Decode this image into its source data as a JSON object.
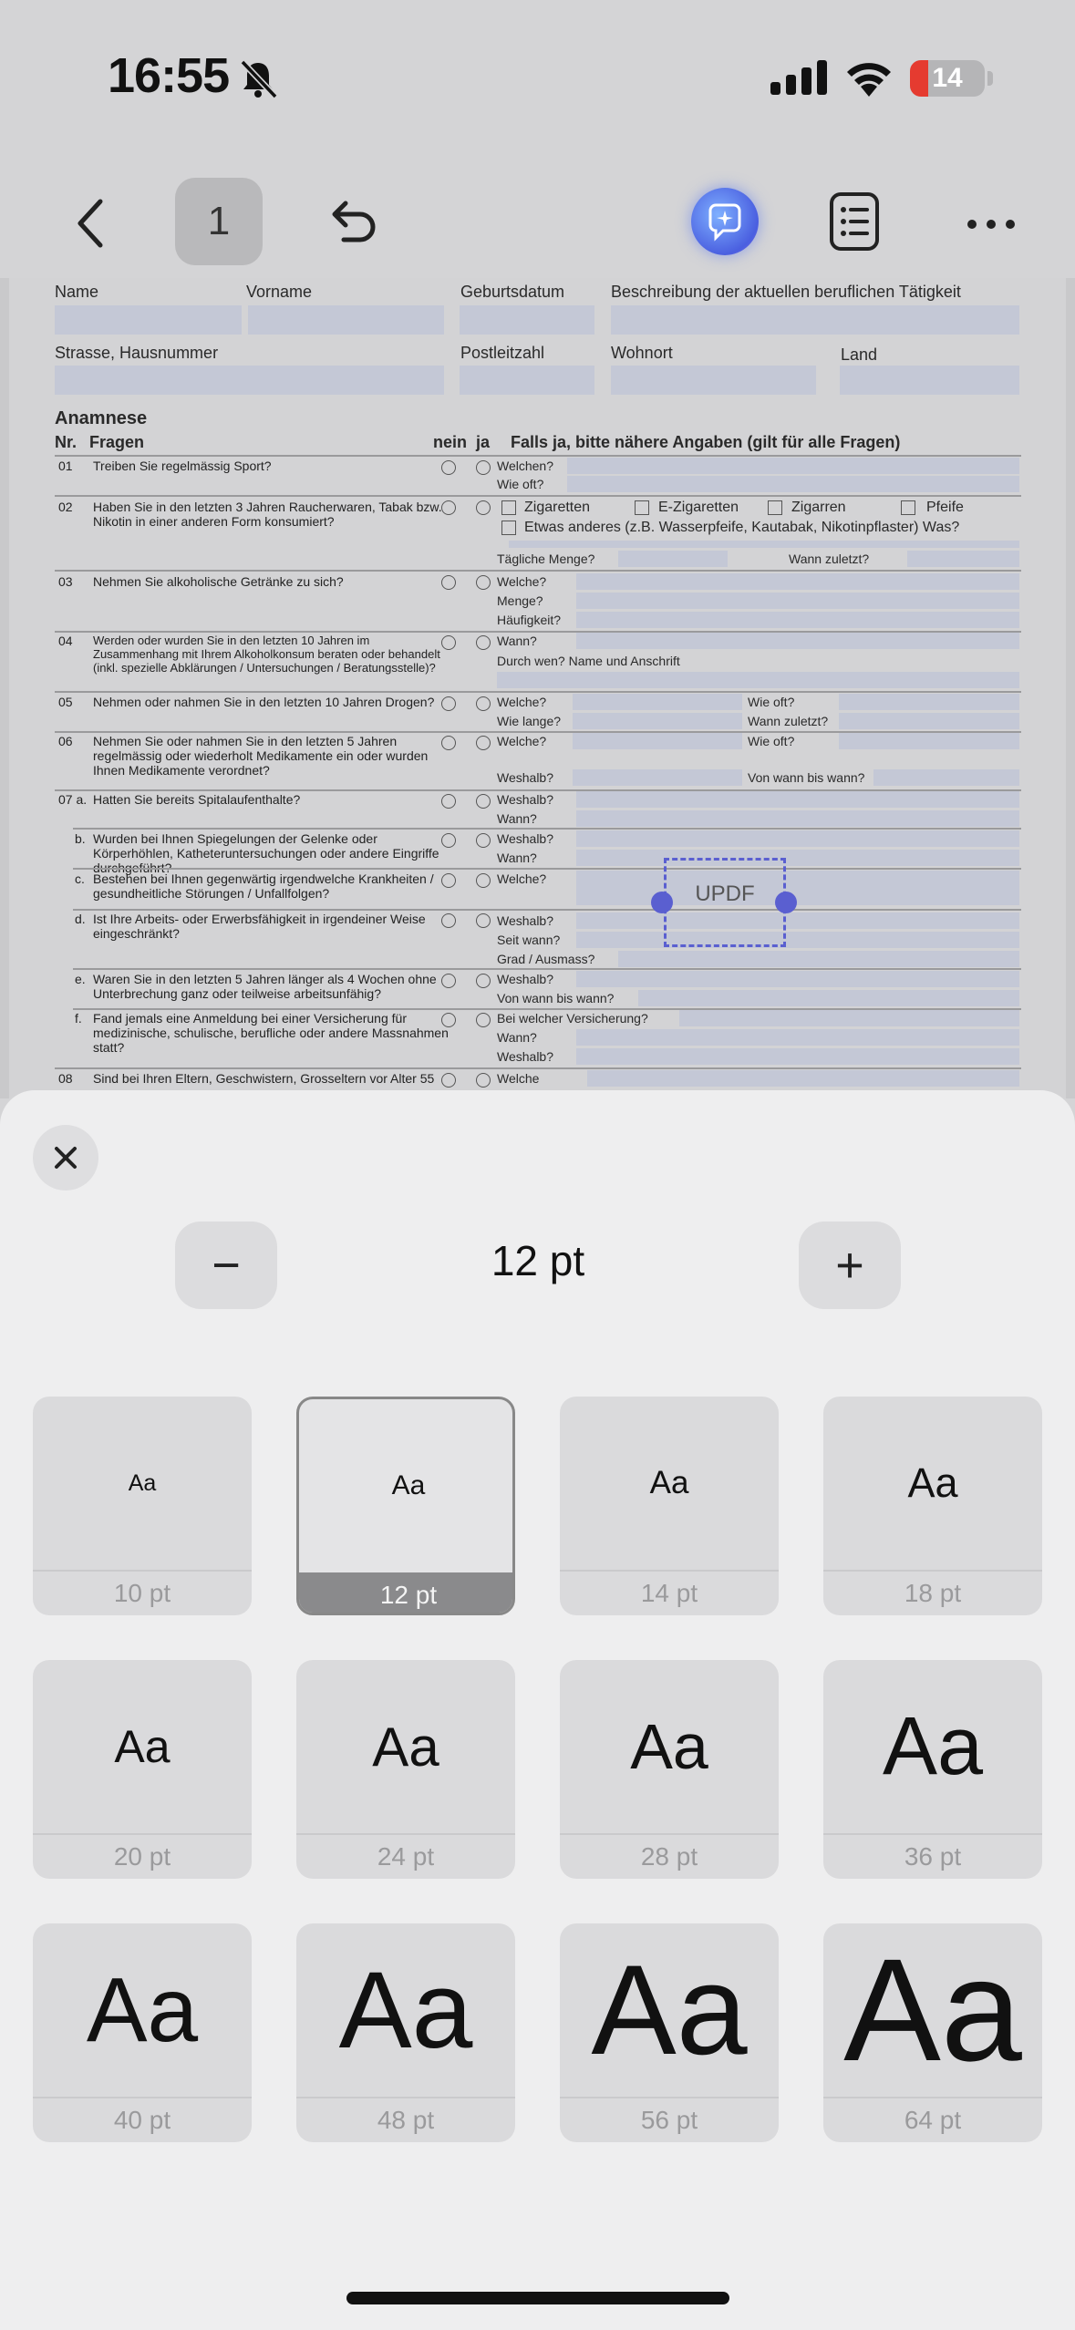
{
  "status_bar": {
    "time": "16:55",
    "battery": "14",
    "icons": [
      "bell-slash-icon",
      "cellular-signal-icon",
      "wifi-icon",
      "battery-icon"
    ]
  },
  "toolbar": {
    "page_number": "1",
    "icons": [
      "chevron-left-icon",
      "undo-icon",
      "ai-assistant-icon",
      "outline-list-icon",
      "more-horizontal-icon"
    ]
  },
  "document": {
    "header_labels": [
      "Name",
      "Vorname",
      "Geburtsdatum",
      "Beschreibung der aktuellen beruflichen Tätigkeit",
      "Strasse, Hausnummer",
      "Postleitzahl",
      "Wohnort",
      "Land"
    ],
    "section_title": "Anamnese",
    "col_nr": "Nr.",
    "col_fragen": "Fragen",
    "col_nein": "nein",
    "col_ja": "ja",
    "col_details": "Falls ja, bitte nähere Angaben (gilt für alle Fragen)",
    "questions": [
      {
        "nr": "01",
        "text": "Treiben Sie regelmässig Sport?"
      },
      {
        "nr": "02",
        "text": "Haben Sie in den letzten 3 Jahren Raucherwaren, Tabak bzw. Nikotin in einer anderen Form konsumiert?"
      },
      {
        "nr": "03",
        "text": "Nehmen Sie alkoholische Getränke zu sich?"
      },
      {
        "nr": "04",
        "text": "Werden oder wurden Sie in den letzten 10 Jahren im Zusammenhang mit Ihrem Alkoholkonsum beraten oder behandelt (inkl. spezielle Abklärungen / Untersuchungen / Beratungsstelle)?"
      },
      {
        "nr": "05",
        "text": "Nehmen oder nahmen Sie in den letzten 10 Jahren Drogen?"
      },
      {
        "nr": "06",
        "text": "Nehmen Sie oder nahmen Sie in den letzten 5 Jahren regelmässig oder wiederholt Medikamente ein oder wurden Ihnen Medikamente verordnet?"
      },
      {
        "nr": "07 a.",
        "text": "Hatten Sie bereits Spitalaufenthalte?"
      },
      {
        "nr": "b.",
        "text": "Wurden bei Ihnen Spiegelungen der Gelenke oder Körperhöhlen, Katheteruntersuchungen oder andere Eingriffe durchgeführt?"
      },
      {
        "nr": "c.",
        "text": "Bestehen bei Ihnen gegenwärtig irgendwelche Krankheiten / gesundheitliche Störungen / Unfallfolgen?"
      },
      {
        "nr": "d.",
        "text": "Ist Ihre Arbeits- oder Erwerbsfähigkeit in irgendeiner Weise eingeschränkt?"
      },
      {
        "nr": "e.",
        "text": "Waren Sie in den letzten 5 Jahren länger als 4 Wochen ohne Unterbrechung ganz oder teilweise arbeitsunfähig?"
      },
      {
        "nr": "f.",
        "text": "Fand jemals eine Anmeldung bei einer Versicherung für medizinische, schulische, berufliche oder andere Massnahmen statt?"
      },
      {
        "nr": "08",
        "text": "Sind bei Ihren Eltern, Geschwistern, Grosseltern vor Alter 55"
      }
    ],
    "detail_labels": {
      "q01_a": "Welchen?",
      "q01_b": "Wie oft?",
      "q02_zig": "Zigaretten",
      "q02_ezig": "E-Zigaretten",
      "q02_zigarren": "Zigarren",
      "q02_pfeife": "Pfeife",
      "q02_etwas": "Etwas anderes (z.B. Wasserpfeife, Kautabak, Nikotinpflaster) Was?",
      "q02_menge": "Tägliche Menge?",
      "q02_wann": "Wann zuletzt?",
      "q03_a": "Welche?",
      "q03_b": "Menge?",
      "q03_c": "Häufigkeit?",
      "q04_a": "Wann?",
      "q04_b": "Durch wen? Name und Anschrift",
      "q05_a": "Welche?",
      "q05_b": "Wie oft?",
      "q05_c": "Wie lange?",
      "q05_d": "Wann zuletzt?",
      "q06_a": "Welche?",
      "q06_b": "Wie oft?",
      "q06_c": "Weshalb?",
      "q06_d": "Von wann bis wann?",
      "q07a_a": "Weshalb?",
      "q07a_b": "Wann?",
      "q07b_a": "Weshalb?",
      "q07b_b": "Wann?",
      "q07c_a": "Welche?",
      "q07d_a": "Weshalb?",
      "q07d_b": "Seit wann?",
      "q07d_c": "Grad / Ausmass?",
      "q07e_a": "Weshalb?",
      "q07e_b": "Von wann bis wann?",
      "q07f_a": "Bei welcher Versicherung?",
      "q07f_b": "Wann?",
      "q07f_c": "Weshalb?",
      "q08_a": "Welche"
    },
    "text_box_label": "UPDF"
  },
  "font_size_sheet": {
    "current_value": "12 pt",
    "minus_label": "−",
    "plus_label": "+",
    "selected_index": 1,
    "sizes": [
      {
        "label": "10 pt",
        "sample": "Aa",
        "pt": 10
      },
      {
        "label": "12 pt",
        "sample": "Aa",
        "pt": 12
      },
      {
        "label": "14 pt",
        "sample": "Aa",
        "pt": 14
      },
      {
        "label": "18 pt",
        "sample": "Aa",
        "pt": 18
      },
      {
        "label": "20 pt",
        "sample": "Aa",
        "pt": 20
      },
      {
        "label": "24 pt",
        "sample": "Aa",
        "pt": 24
      },
      {
        "label": "28 pt",
        "sample": "Aa",
        "pt": 28
      },
      {
        "label": "36 pt",
        "sample": "Aa",
        "pt": 36
      },
      {
        "label": "40 pt",
        "sample": "Aa",
        "pt": 40
      },
      {
        "label": "48 pt",
        "sample": "Aa",
        "pt": 48
      },
      {
        "label": "56 pt",
        "sample": "Aa",
        "pt": 56
      },
      {
        "label": "64 pt",
        "sample": "Aa",
        "pt": 64
      }
    ]
  },
  "colors": {
    "accent": "#5a5fd0",
    "selected_caption": "#8a8a8c",
    "battery_low": "#e53b30"
  }
}
